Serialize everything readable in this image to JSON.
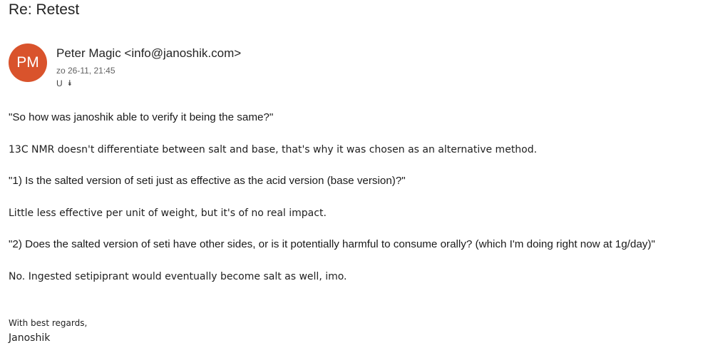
{
  "message": {
    "subject": "Re: Retest",
    "sender": {
      "initials": "PM",
      "avatar_color": "#d9532c",
      "display": "Peter Magic <info@janoshik.com>"
    },
    "datetime": "zo 26-11, 21:45",
    "recipient_initial": "U",
    "body": {
      "quote1": "\"So how was janoshik able to verify it being the same?\"",
      "reply1": "13C NMR doesn't differentiate between salt and base, that's why it was chosen as an alternative method.",
      "quote2": "\"1) Is the salted version of seti just as effective as the acid version (base version)?\"",
      "reply2": "Little less effective per unit of weight, but it's of no real impact.",
      "quote3": "\"2) Does the salted version of seti have other sides, or is it potentially harmful to consume orally? (which I'm doing right now at 1g/day)\"",
      "reply3": "No. Ingested setipiprant would eventually become salt as well, imo."
    },
    "signature": {
      "closing": "With best regards,",
      "name": "Janoshik"
    }
  },
  "icons": {
    "expand_recipients": "double-chevron-down-icon"
  }
}
